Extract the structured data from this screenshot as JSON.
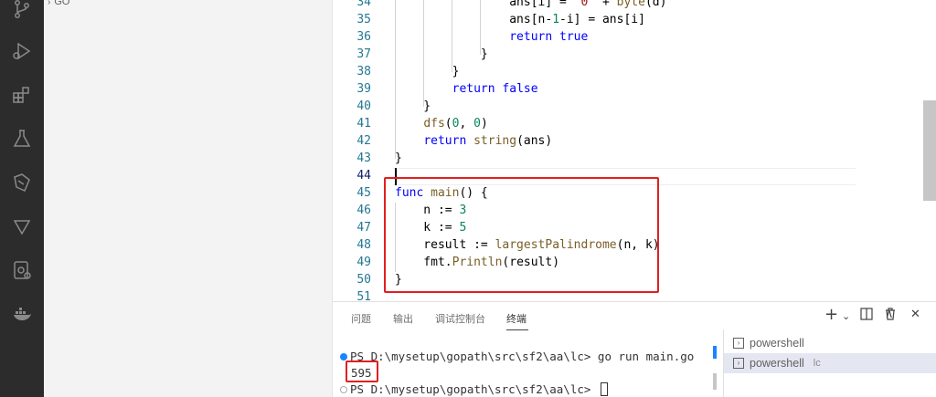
{
  "sidebar": {
    "section_label": "GO"
  },
  "editor": {
    "lines": [
      {
        "n": "34",
        "code": [
          [
            "",
            "                ans[i] = "
          ],
          [
            "str",
            "'0'"
          ],
          [
            "",
            " + "
          ],
          [
            "fn",
            "byte"
          ],
          [
            "",
            "(d)"
          ]
        ]
      },
      {
        "n": "35",
        "code": [
          [
            "",
            "                ans[n-"
          ],
          [
            "num",
            "1"
          ],
          [
            "",
            "-i] = ans[i]"
          ]
        ]
      },
      {
        "n": "36",
        "code": [
          [
            "",
            "                "
          ],
          [
            "kw",
            "return"
          ],
          [
            "",
            " "
          ],
          [
            "kw",
            "true"
          ]
        ]
      },
      {
        "n": "37",
        "code": [
          [
            "",
            "            }"
          ]
        ]
      },
      {
        "n": "38",
        "code": [
          [
            "",
            "        }"
          ]
        ]
      },
      {
        "n": "39",
        "code": [
          [
            "",
            "        "
          ],
          [
            "kw",
            "return"
          ],
          [
            "",
            " "
          ],
          [
            "kw",
            "false"
          ]
        ]
      },
      {
        "n": "40",
        "code": [
          [
            "",
            "    }"
          ]
        ]
      },
      {
        "n": "41",
        "code": [
          [
            "",
            "    "
          ],
          [
            "fn",
            "dfs"
          ],
          [
            "",
            "("
          ],
          [
            "num",
            "0"
          ],
          [
            "",
            ", "
          ],
          [
            "num",
            "0"
          ],
          [
            "",
            ")"
          ]
        ]
      },
      {
        "n": "42",
        "code": [
          [
            "",
            "    "
          ],
          [
            "kw",
            "return"
          ],
          [
            "",
            " "
          ],
          [
            "fn",
            "string"
          ],
          [
            "",
            "(ans)"
          ]
        ]
      },
      {
        "n": "43",
        "code": [
          [
            "",
            "}"
          ]
        ]
      },
      {
        "n": "44",
        "code": [
          [
            "",
            ""
          ]
        ]
      },
      {
        "n": "45",
        "code": [
          [
            "kw",
            "func"
          ],
          [
            "",
            " "
          ],
          [
            "fn",
            "main"
          ],
          [
            "",
            "() {"
          ]
        ]
      },
      {
        "n": "46",
        "code": [
          [
            "",
            "    n := "
          ],
          [
            "num",
            "3"
          ]
        ]
      },
      {
        "n": "47",
        "code": [
          [
            "",
            "    k := "
          ],
          [
            "num",
            "5"
          ]
        ]
      },
      {
        "n": "48",
        "code": [
          [
            "",
            "    result := "
          ],
          [
            "fn",
            "largestPalindrome"
          ],
          [
            "",
            "(n, k)"
          ]
        ]
      },
      {
        "n": "49",
        "code": [
          [
            "",
            "    fmt."
          ],
          [
            "fn",
            "Println"
          ],
          [
            "",
            "(result)"
          ]
        ]
      },
      {
        "n": "50",
        "code": [
          [
            "",
            "}"
          ]
        ]
      },
      {
        "n": "51",
        "code": [
          [
            "",
            ""
          ]
        ]
      }
    ]
  },
  "panel": {
    "tabs": [
      "问题",
      "输出",
      "调试控制台",
      "终端"
    ],
    "active_tab": "终端",
    "tools": {
      "add": "+",
      "dropdown": "⌄",
      "split": "◫",
      "trash": "🗑",
      "maximize": "∧",
      "close": "✕"
    },
    "terminal": {
      "prompt1": "PS D:\\mysetup\\gopath\\src\\sf2\\aa\\lc> go run main.go",
      "output": "595",
      "prompt2": "PS D:\\mysetup\\gopath\\src\\sf2\\aa\\lc> "
    },
    "terminal_list": [
      {
        "label": "powershell",
        "suffix": ""
      },
      {
        "label": "powershell",
        "suffix": "lc"
      }
    ]
  },
  "colors": {
    "activity_bar": "#2c2c2c",
    "keyword": "#0000ff",
    "number": "#098658",
    "string": "#a31515",
    "function": "#795e26",
    "highlight": "#e02020"
  },
  "icons": [
    "source-control-icon",
    "run-debug-icon",
    "extensions-icon",
    "testing-icon",
    "remote-icon",
    "gitlens-icon",
    "remote-explorer-icon",
    "docker-icon"
  ]
}
